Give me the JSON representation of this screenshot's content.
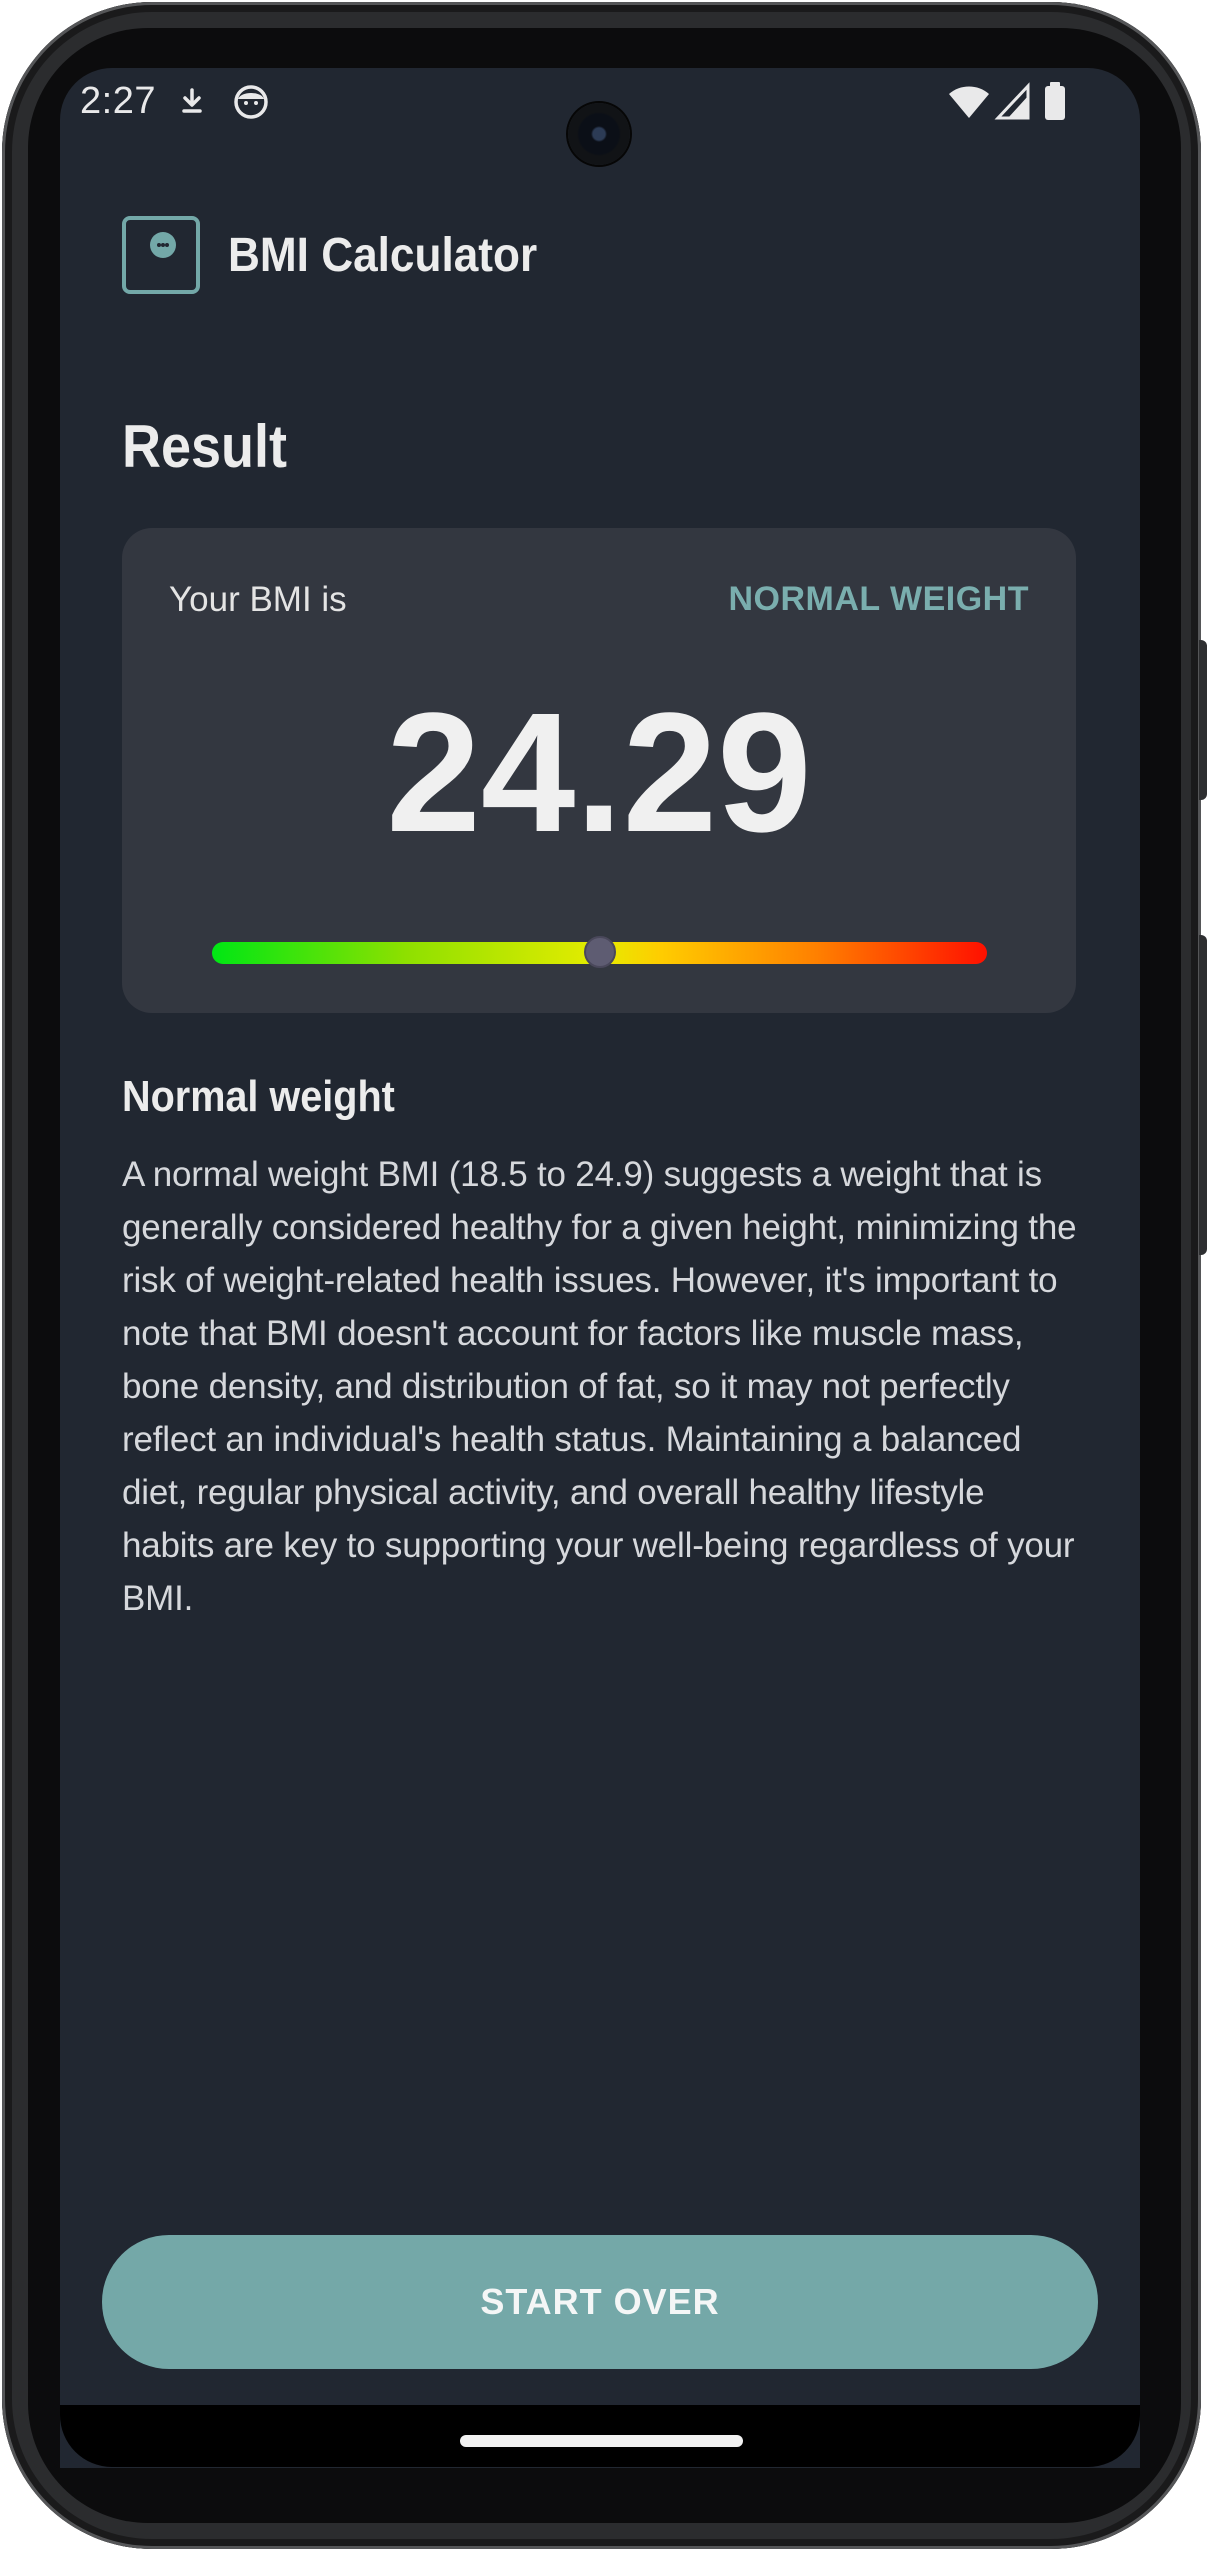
{
  "status_bar": {
    "time": "2:27",
    "left_icons": [
      "download-arrow-icon",
      "face-icon"
    ],
    "right_icons": [
      "wifi-icon",
      "cell-signal-icon",
      "battery-icon"
    ]
  },
  "header": {
    "logo_icon": "bmi-scale-icon",
    "title": "BMI Calculator"
  },
  "result": {
    "section_title": "Result",
    "label": "Your BMI is",
    "category": "NORMAL WEIGHT",
    "value": "24.29",
    "scale_position_fraction": 0.5
  },
  "description": {
    "title": "Normal weight",
    "body": "A normal weight BMI (18.5 to 24.9) suggests a weight that is generally considered healthy for a given height, minimizing the risk of weight-related health issues. However, it's important to note that BMI doesn't account for factors like muscle mass, bone density, and distribution of fat, so it may not perfectly reflect an individual's health status. Maintaining a balanced diet, regular physical activity, and overall healthy lifestyle habits are key to supporting your well-being regardless of your BMI."
  },
  "actions": {
    "start_over_label": "START OVER"
  },
  "colors": {
    "background": "#212731",
    "card": "#333740",
    "accent": "#74a8a8",
    "text_primary": "#ececec"
  }
}
